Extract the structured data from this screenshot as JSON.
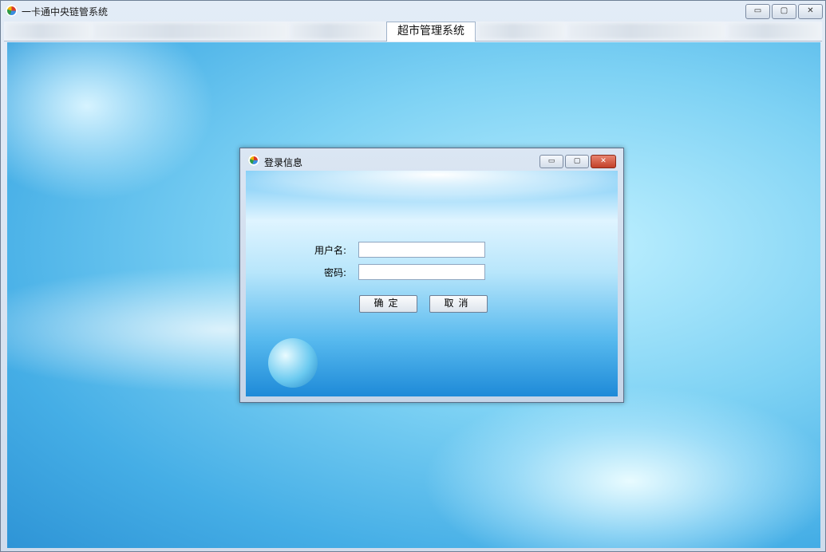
{
  "window": {
    "title": "一卡通中央链管系统",
    "controls": {
      "minimize": "▭",
      "maximize": "▢",
      "close": "✕"
    }
  },
  "tabs": [
    {
      "label": "",
      "obscured": true
    },
    {
      "label": "",
      "obscured": true
    },
    {
      "label": "",
      "obscured": true
    },
    {
      "label": "超市管理系统",
      "active": true
    },
    {
      "label": "",
      "obscured": true
    },
    {
      "label": "",
      "obscured": true
    },
    {
      "label": "",
      "obscured": true
    }
  ],
  "dialog": {
    "title": "登录信息",
    "username_label": "用户名:",
    "username_value": "",
    "password_label": "密码:",
    "password_value": "",
    "ok_label": "确定",
    "cancel_label": "取消"
  },
  "colors": {
    "accent": "#45aee6",
    "close": "#c2412a"
  }
}
